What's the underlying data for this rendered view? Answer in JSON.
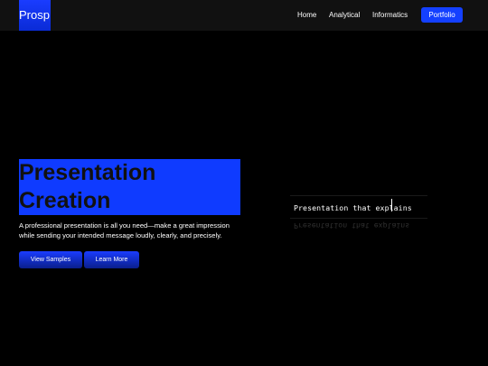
{
  "nav": {
    "logo": "Prosp",
    "links": [
      "Home",
      "Analytical",
      "Informatics"
    ],
    "cta": "Portfolio"
  },
  "hero": {
    "title_line1": "Presentation",
    "title_line2": "Creation",
    "description_line1": "A professional presentation is all you need—make a great impression",
    "description_line2": "while sending your intended message loudly, clearly, and precisely.",
    "primary_button": "View Samples",
    "secondary_button": "Learn More"
  },
  "tagline": {
    "text": "Presentation that explains"
  },
  "colors": {
    "accent": "#0f3bff",
    "background": "#000000",
    "navbar": "#111111"
  }
}
